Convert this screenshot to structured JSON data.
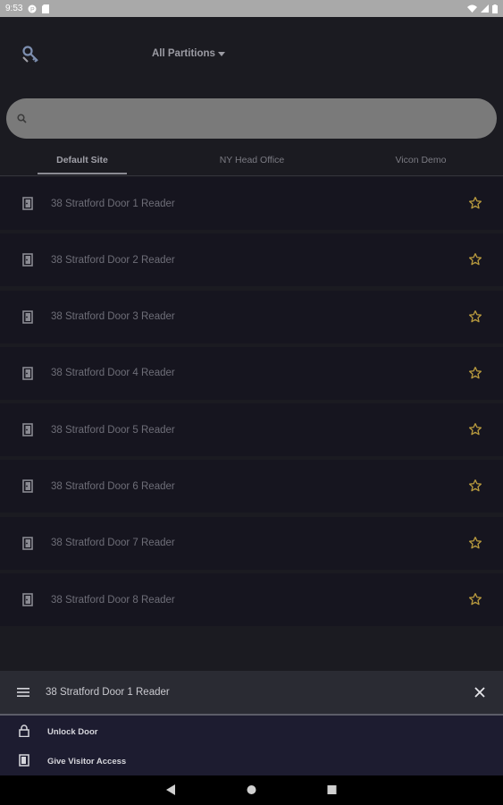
{
  "status_bar": {
    "time": "9:53",
    "icons": [
      "app-notification-icon",
      "sd-card-icon",
      "wifi-icon",
      "signal-icon",
      "battery-icon"
    ]
  },
  "header": {
    "logo_icon": "key-logo-icon",
    "partition_label": "All Partitions"
  },
  "search": {
    "placeholder": "",
    "value": ""
  },
  "tabs": [
    {
      "label": "Default Site",
      "active": true
    },
    {
      "label": "NY Head Office",
      "active": false
    },
    {
      "label": "Vicon Demo",
      "active": false
    }
  ],
  "doors": [
    {
      "label": "38 Stratford Door 1 Reader",
      "favorite": false
    },
    {
      "label": "38 Stratford Door 2 Reader",
      "favorite": false
    },
    {
      "label": "38 Stratford Door 3 Reader",
      "favorite": false
    },
    {
      "label": "38 Stratford Door 4 Reader",
      "favorite": false
    },
    {
      "label": "38 Stratford Door 5 Reader",
      "favorite": false
    },
    {
      "label": "38 Stratford Door 6 Reader",
      "favorite": false
    },
    {
      "label": "38 Stratford Door 7 Reader",
      "favorite": false
    },
    {
      "label": "38 Stratford Door 8 Reader",
      "favorite": false
    }
  ],
  "bottom_sheet": {
    "title": "38 Stratford Door 1 Reader",
    "actions": [
      {
        "label": "Unlock Door",
        "icon": "lock-icon"
      },
      {
        "label": "Give Visitor Access",
        "icon": "visitor-door-icon"
      }
    ]
  },
  "nav_bar": {
    "buttons": [
      "back-icon",
      "home-icon",
      "recents-icon"
    ]
  },
  "colors": {
    "background": "#1b1b21",
    "row_background": "#16151f",
    "star": "#b89a3e",
    "search_background": "#7a7a7a",
    "sheet_header": "#2a2b33",
    "sheet_body": "#1d1c30"
  }
}
